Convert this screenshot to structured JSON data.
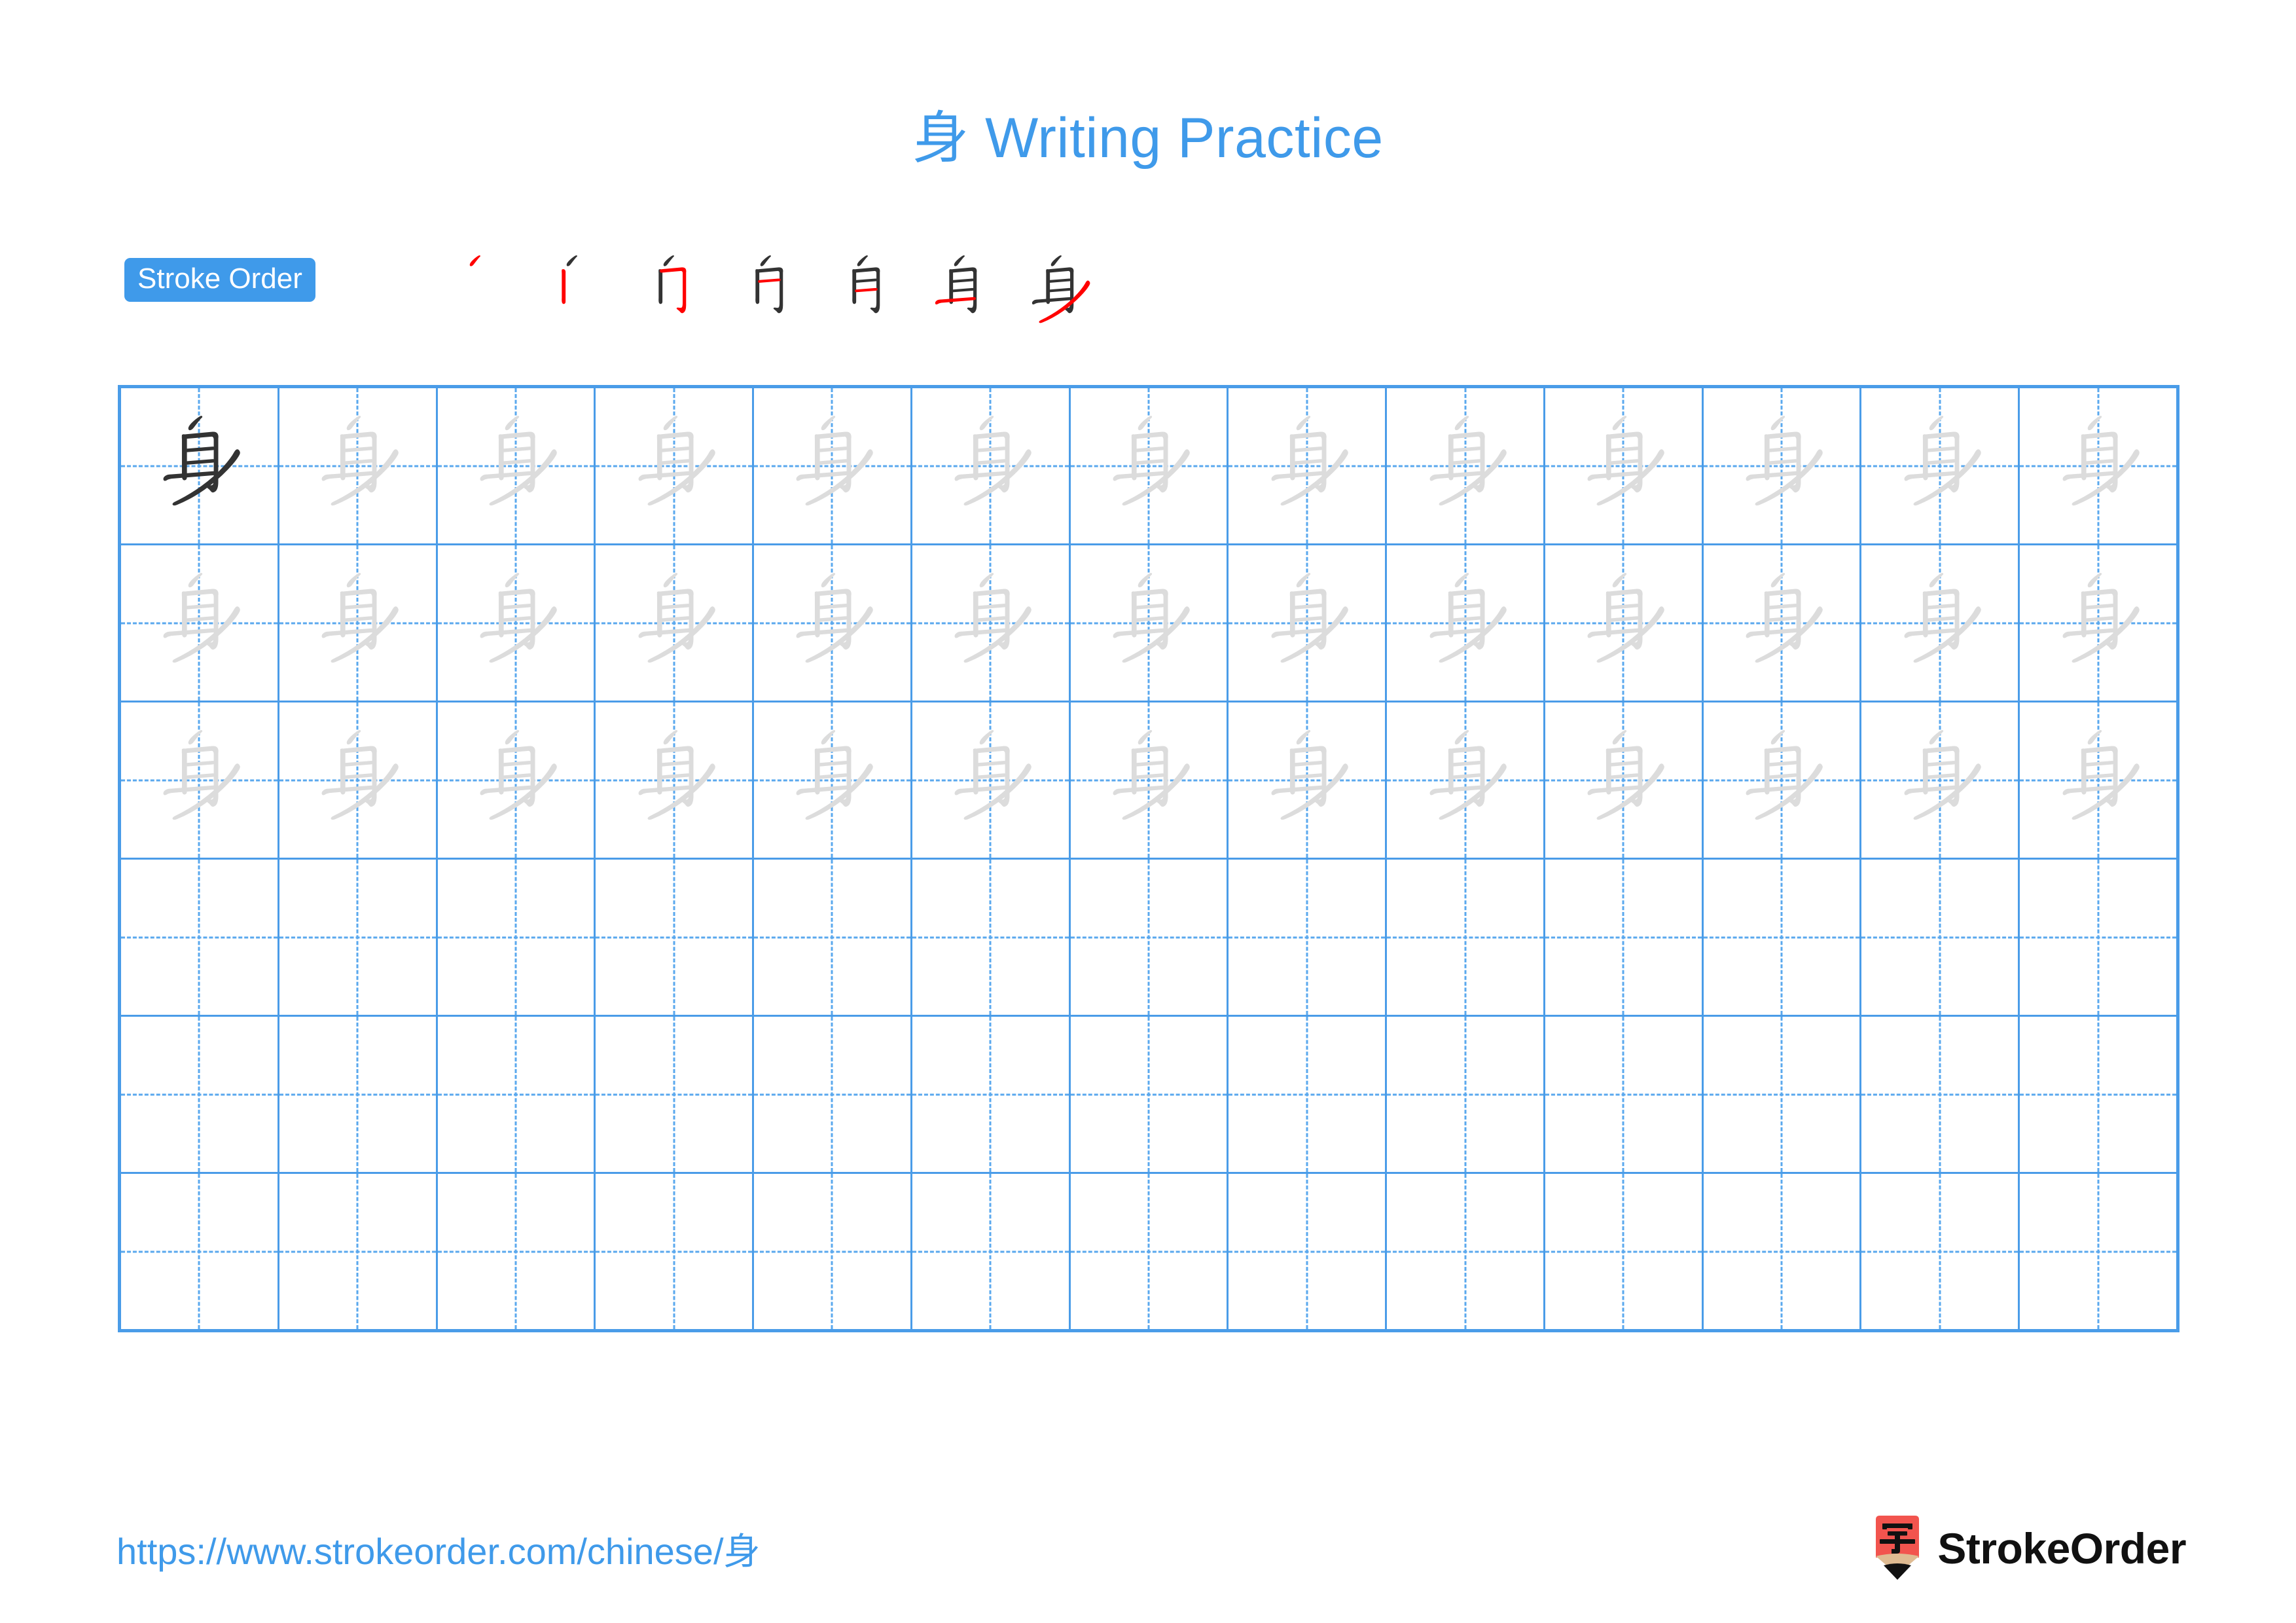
{
  "character": "身",
  "title": {
    "character": "身",
    "suffix": " Writing Practice",
    "full": "身 Writing Practice",
    "color": "#3f9aea"
  },
  "stroke_order": {
    "badge_label": "Stroke Order",
    "badge_bg": "#3f9aea",
    "badge_text_color": "#ffffff",
    "stroke_count": 7,
    "new_stroke_color": "#ff0000",
    "prior_stroke_color": "#333333",
    "steps": [
      {
        "index": 1,
        "strokes_shown": 1,
        "new_stroke": "撇 (pie)"
      },
      {
        "index": 2,
        "strokes_shown": 2,
        "new_stroke": "竖 (shu)"
      },
      {
        "index": 3,
        "strokes_shown": 3,
        "new_stroke": "横折钩 (heng zhe gou)"
      },
      {
        "index": 4,
        "strokes_shown": 4,
        "new_stroke": "横 (heng)"
      },
      {
        "index": 5,
        "strokes_shown": 5,
        "new_stroke": "横 (heng)"
      },
      {
        "index": 6,
        "strokes_shown": 6,
        "new_stroke": "横 (heng)"
      },
      {
        "index": 7,
        "strokes_shown": 7,
        "new_stroke": "撇 (pie)"
      }
    ]
  },
  "practice_grid": {
    "columns": 13,
    "rows": 6,
    "border_color": "#4a9ce8",
    "guide_color": "#5aa8ee",
    "model_char_color": "#333333",
    "trace_char_color": "#dcdcdc",
    "rows_data": [
      {
        "row": 1,
        "cells": [
          "model",
          "trace",
          "trace",
          "trace",
          "trace",
          "trace",
          "trace",
          "trace",
          "trace",
          "trace",
          "trace",
          "trace",
          "trace"
        ]
      },
      {
        "row": 2,
        "cells": [
          "trace",
          "trace",
          "trace",
          "trace",
          "trace",
          "trace",
          "trace",
          "trace",
          "trace",
          "trace",
          "trace",
          "trace",
          "trace"
        ]
      },
      {
        "row": 3,
        "cells": [
          "trace",
          "trace",
          "trace",
          "trace",
          "trace",
          "trace",
          "trace",
          "trace",
          "trace",
          "trace",
          "trace",
          "trace",
          "trace"
        ]
      },
      {
        "row": 4,
        "cells": [
          "empty",
          "empty",
          "empty",
          "empty",
          "empty",
          "empty",
          "empty",
          "empty",
          "empty",
          "empty",
          "empty",
          "empty",
          "empty"
        ]
      },
      {
        "row": 5,
        "cells": [
          "empty",
          "empty",
          "empty",
          "empty",
          "empty",
          "empty",
          "empty",
          "empty",
          "empty",
          "empty",
          "empty",
          "empty",
          "empty"
        ]
      },
      {
        "row": 6,
        "cells": [
          "empty",
          "empty",
          "empty",
          "empty",
          "empty",
          "empty",
          "empty",
          "empty",
          "empty",
          "empty",
          "empty",
          "empty",
          "empty"
        ]
      }
    ]
  },
  "footer": {
    "url": "https://www.strokeorder.com/chinese/身",
    "url_prefix": "https://www.strokeorder.com/chinese/",
    "url_character": "身",
    "url_color": "#3f9aea",
    "brand_name": "StrokeOrder",
    "brand_mark_character": "字",
    "brand_mark_body_color": "#f2544e",
    "brand_mark_wood_color": "#dfbb92",
    "brand_mark_tip_color": "#111111",
    "brand_text_color": "#111111"
  }
}
